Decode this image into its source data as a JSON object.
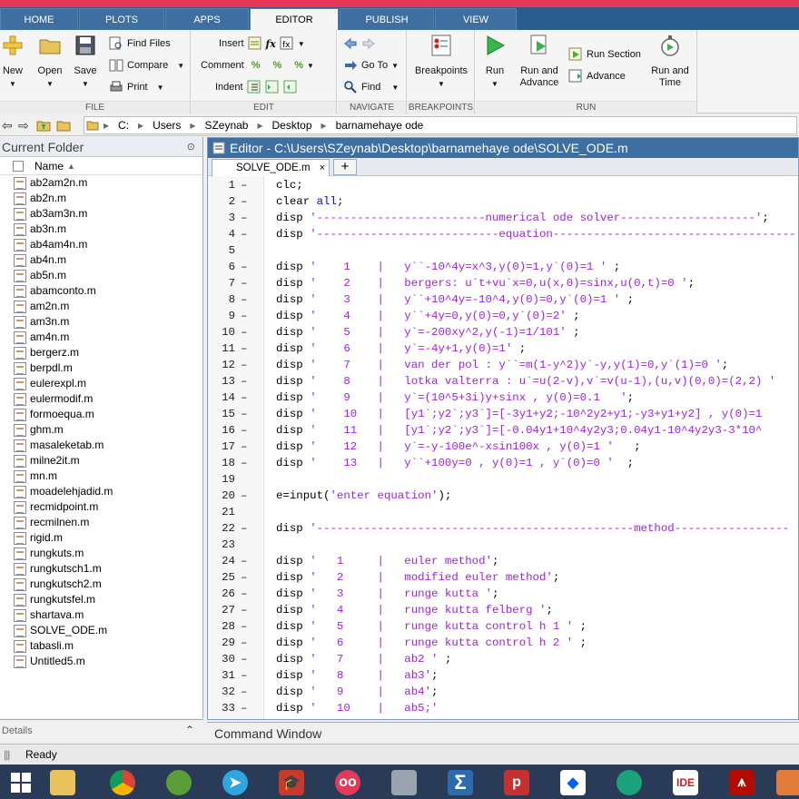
{
  "tabs": [
    "HOME",
    "PLOTS",
    "APPS",
    "EDITOR",
    "PUBLISH",
    "VIEW"
  ],
  "active_tab": "EDITOR",
  "ribbon": {
    "file": {
      "label": "FILE",
      "new": "New",
      "open": "Open",
      "save": "Save",
      "find_files": "Find Files",
      "compare": "Compare",
      "print": "Print"
    },
    "edit": {
      "label": "EDIT",
      "insert": "Insert",
      "comment": "Comment",
      "indent": "Indent"
    },
    "navigate": {
      "label": "NAVIGATE",
      "goto": "Go To",
      "find": "Find"
    },
    "breakpoints": {
      "label": "BREAKPOINTS",
      "breakpoints": "Breakpoints"
    },
    "run": {
      "label": "RUN",
      "run": "Run",
      "run_advance_1": "Run and",
      "run_advance_2": "Advance",
      "run_section": "Run Section",
      "advance": "Advance",
      "run_time_1": "Run and",
      "run_time_2": "Time"
    }
  },
  "path": [
    "C:",
    "Users",
    "SZeynab",
    "Desktop",
    "barnamehaye ode"
  ],
  "current_folder": {
    "title": "Current Folder",
    "column": "Name",
    "files": [
      "ab2am2n.m",
      "ab2n.m",
      "ab3am3n.m",
      "ab3n.m",
      "ab4am4n.m",
      "ab4n.m",
      "ab5n.m",
      "abamconto.m",
      "am2n.m",
      "am3n.m",
      "am4n.m",
      "bergerz.m",
      "berpdl.m",
      "eulerexpl.m",
      "eulermodif.m",
      "formoequa.m",
      "ghm.m",
      "masaleketab.m",
      "milne2it.m",
      "mn.m",
      "moadelehjadid.m",
      "recmidpoint.m",
      "recmilnen.m",
      "rigid.m",
      "rungkuts.m",
      "rungkutsch1.m",
      "rungkutsch2.m",
      "rungkutsfel.m",
      "shartava.m",
      "SOLVE_ODE.m",
      "tabasli.m",
      "Untitled5.m"
    ]
  },
  "details_label": "Details",
  "editor": {
    "title": "Editor - C:\\Users\\SZeynab\\Desktop\\barnamehaye ode\\SOLVE_ODE.m",
    "tab": "SOLVE_ODE.m",
    "plus": "+",
    "lines": [
      {
        "n": "1",
        "dash": "–",
        "kw": "",
        "text": "clc;"
      },
      {
        "n": "2",
        "dash": "–",
        "kw": "",
        "text": "clear all;"
      },
      {
        "n": "3",
        "dash": "–",
        "kw": "",
        "text": "disp '-------------------------numerical ode solver--------------------';"
      },
      {
        "n": "4",
        "dash": "–",
        "kw": "",
        "text": "disp '---------------------------equation------------------------------------"
      },
      {
        "n": "5",
        "dash": "",
        "kw": "",
        "text": ""
      },
      {
        "n": "6",
        "dash": "–",
        "kw": "",
        "text": "disp '    1    |   y``-10^4y=x^3,y(0)=1,y`(0)=1 ' ;"
      },
      {
        "n": "7",
        "dash": "–",
        "kw": "",
        "text": "disp '    2    |   bergers: u`t+vu`x=0,u(x,0)=sinx,u(0,t)=0 ';"
      },
      {
        "n": "8",
        "dash": "–",
        "kw": "",
        "text": "disp '    3    |   y``+10^4y=-10^4,y(0)=0,y`(0)=1 ' ;"
      },
      {
        "n": "9",
        "dash": "–",
        "kw": "",
        "text": "disp '    4    |   y``+4y=0,y(0)=0,y`(0)=2' ;"
      },
      {
        "n": "10",
        "dash": "–",
        "kw": "",
        "text": "disp '    5    |   y`=-200xy^2,y(-1)=1/101' ;"
      },
      {
        "n": "11",
        "dash": "–",
        "kw": "",
        "text": "disp '    6    |   y`=-4y+1,y(0)=1' ;"
      },
      {
        "n": "12",
        "dash": "–",
        "kw": "",
        "text": "disp '    7    |   van der pol : y``=m(1-y^2)y`-y,y(1)=0,y`(1)=0 ';"
      },
      {
        "n": "13",
        "dash": "–",
        "kw": "",
        "text": "disp '    8    |   lotka valterra : u`=u(2-v),v`=v(u-1),(u,v)(0,0)=(2,2) '"
      },
      {
        "n": "14",
        "dash": "–",
        "kw": "",
        "text": "disp '    9    |   y`=(10^5+3i)y+sinx , y(0)=0.1   ';"
      },
      {
        "n": "15",
        "dash": "–",
        "kw": "",
        "text": "disp '    10   |   [y1`;y2`;y3`]=[-3y1+y2;-10^2y2+y1;-y3+y1+y2] , y(0)=1"
      },
      {
        "n": "16",
        "dash": "–",
        "kw": "",
        "text": "disp '    11   |   [y1`;y2`;y3`]=[-0.04y1+10^4y2y3;0.04y1-10^4y2y3-3*10^"
      },
      {
        "n": "17",
        "dash": "–",
        "kw": "",
        "text": "disp '    12   |   y`=-y-100e^-xsin100x , y(0)=1 '   ;"
      },
      {
        "n": "18",
        "dash": "–",
        "kw": "",
        "text": "disp '    13   |   y``+100y=0 , y(0)=1 , y`(0)=0 '  ;"
      },
      {
        "n": "19",
        "dash": "",
        "kw": "",
        "text": ""
      },
      {
        "n": "20",
        "dash": "–",
        "kw": "",
        "text": "e=input('enter equation');"
      },
      {
        "n": "21",
        "dash": "",
        "kw": "",
        "text": ""
      },
      {
        "n": "22",
        "dash": "–",
        "kw": "",
        "text": "disp '-----------------------------------------------method-----------------"
      },
      {
        "n": "23",
        "dash": "",
        "kw": "",
        "text": ""
      },
      {
        "n": "24",
        "dash": "–",
        "kw": "",
        "text": "disp '   1     |   euler method';"
      },
      {
        "n": "25",
        "dash": "–",
        "kw": "",
        "text": "disp '   2     |   modified euler method';"
      },
      {
        "n": "26",
        "dash": "–",
        "kw": "",
        "text": "disp '   3     |   runge kutta ';"
      },
      {
        "n": "27",
        "dash": "–",
        "kw": "",
        "text": "disp '   4     |   runge kutta felberg ';"
      },
      {
        "n": "28",
        "dash": "–",
        "kw": "",
        "text": "disp '   5     |   runge kutta control h 1 ' ;"
      },
      {
        "n": "29",
        "dash": "–",
        "kw": "",
        "text": "disp '   6     |   runge kutta control h 2 ' ;"
      },
      {
        "n": "30",
        "dash": "–",
        "kw": "",
        "text": "disp '   7     |   ab2 ' ;"
      },
      {
        "n": "31",
        "dash": "–",
        "kw": "",
        "text": "disp '   8     |   ab3';"
      },
      {
        "n": "32",
        "dash": "–",
        "kw": "",
        "text": "disp '   9     |   ab4';"
      },
      {
        "n": "33",
        "dash": "–",
        "kw": "",
        "text": "disp '   10    |   ab5;'"
      }
    ]
  },
  "command_window": "Command Window",
  "status": "Ready",
  "taskbar_letters": {
    "p": "p",
    "ide": "IDE"
  }
}
